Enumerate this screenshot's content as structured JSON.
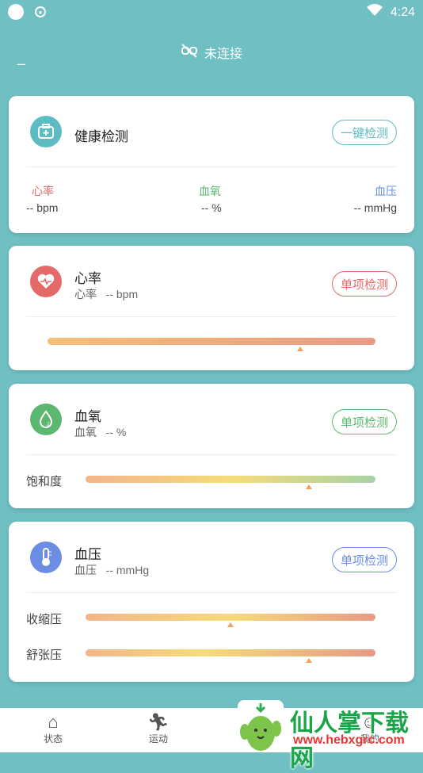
{
  "status": {
    "time": "4:24"
  },
  "connection": {
    "text": "未连接"
  },
  "health": {
    "title": "健康检测",
    "button": "一键检测",
    "metrics": [
      {
        "label": "心率",
        "value": "-- bpm",
        "color": "#e46a6a"
      },
      {
        "label": "血氧",
        "value": "-- %",
        "color": "#5cb870"
      },
      {
        "label": "血压",
        "value": "-- mmHg",
        "color": "#6b8de3"
      }
    ]
  },
  "heart": {
    "title": "心率",
    "sub_label": "心率",
    "sub_value": "-- bpm",
    "button": "单项检测",
    "accent": "#e46a6a",
    "marker": 0.77
  },
  "oxygen": {
    "title": "血氧",
    "sub_label": "血氧",
    "sub_value": "-- %",
    "button": "单项检测",
    "accent": "#5cb870",
    "row_label": "饱和度",
    "marker": 0.77
  },
  "pressure": {
    "title": "血压",
    "sub_label": "血压",
    "sub_value": "-- mmHg",
    "button": "单项检测",
    "accent": "#6b8de3",
    "rows": [
      {
        "label": "收缩压",
        "marker": 0.5
      },
      {
        "label": "舒张压",
        "marker": 0.77
      }
    ]
  },
  "tabs": [
    {
      "label": "状态",
      "icon": "home-icon"
    },
    {
      "label": "运动",
      "icon": "running-icon"
    },
    {
      "label": "我的",
      "icon": "user-icon"
    }
  ],
  "watermark": {
    "text": "仙人掌下载网",
    "url": "www.hebxgrc.com"
  }
}
